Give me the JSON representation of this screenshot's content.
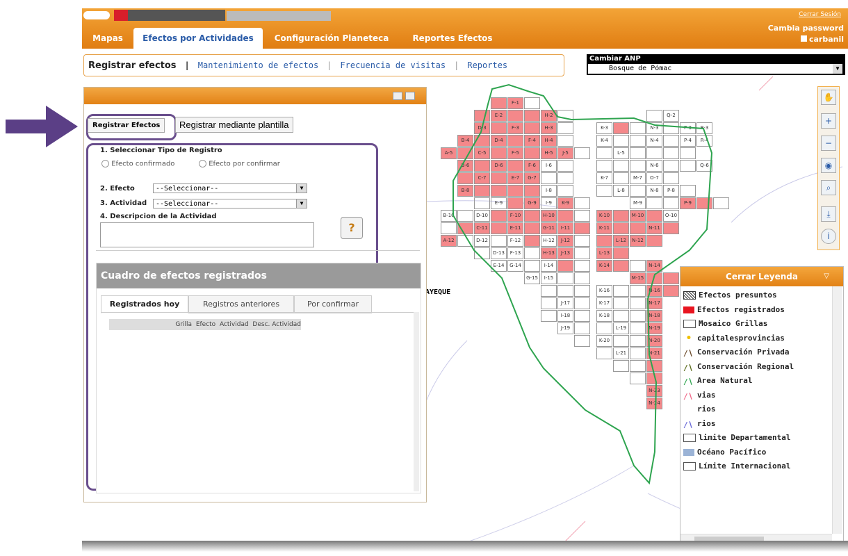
{
  "header": {
    "tabs": [
      "Mapas",
      "Efectos por Actividades",
      "Configuración Planeteca",
      "Reportes Efectos"
    ],
    "active_tab_index": 1,
    "top_right_link": "Cerrar Sesión",
    "change_password": "Cambia password",
    "user": "carbanil"
  },
  "subnav": {
    "items": [
      "Registrar efectos",
      "Mantenimiento de efectos",
      "Frecuencia de visitas",
      "Reportes"
    ],
    "active_index": 0
  },
  "anp": {
    "label": "Cambiar ANP",
    "value": "Bosque de Pómac"
  },
  "panel": {
    "btn_registrar": "Registrar Efectos",
    "btn_plantilla": "Registrar mediante plantilla",
    "section1": "1. Seleccionar Tipo de Registro",
    "radio1": "Efecto confirmado",
    "radio2": "Efecto por confirmar",
    "label_efecto": "2. Efecto",
    "select_efecto": "--Seleccionar--",
    "label_actividad": "3. Actividad",
    "select_actividad": "--Seleccionar--",
    "label_desc": "4. Descripcion de la Actividad",
    "cuadro_title": "Cuadro de efectos registrados",
    "tabs": [
      "Registrados hoy",
      "Registros anteriores",
      "Por confirmar"
    ],
    "columns": [
      "Grilla",
      "Efecto",
      "Actividad",
      "Desc. Actividad"
    ]
  },
  "map": {
    "place_label": "AYEQUE",
    "accent_red": "#f4888a",
    "boundary_green": "#2ea44f"
  },
  "legend": {
    "title": "Cerrar Leyenda",
    "items": [
      {
        "label": "Efectos presuntos",
        "icon": "hatch"
      },
      {
        "label": "Efectos registrados",
        "icon": "red"
      },
      {
        "label": "Mosaico Grillas",
        "icon": "box"
      },
      {
        "label": "capitalesprovincias",
        "icon": "dot"
      },
      {
        "label": "Conservación Privada",
        "icon": "line-brown"
      },
      {
        "label": "Conservación Regional",
        "icon": "line-olive"
      },
      {
        "label": "Area Natural",
        "icon": "line-green"
      },
      {
        "label": "vias",
        "icon": "line-pink"
      },
      {
        "label": "rios",
        "icon": "none"
      },
      {
        "label": "rios",
        "icon": "line-blue"
      },
      {
        "label": "limite Departamental",
        "icon": "box"
      },
      {
        "label": "Océano Pacífico",
        "icon": "blue"
      },
      {
        "label": "Límite Internacional",
        "icon": "box"
      }
    ]
  }
}
